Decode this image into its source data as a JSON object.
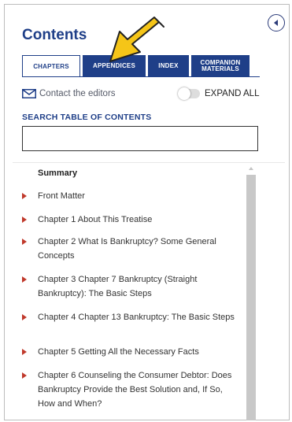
{
  "panel": {
    "title": "Contents",
    "collapse_icon": "chevron-left-circle-icon"
  },
  "tabs": [
    {
      "label": "CHAPTERS",
      "active": true
    },
    {
      "label": "APPENDICES",
      "active": false
    },
    {
      "label": "INDEX",
      "active": false
    },
    {
      "label": "COMPANION MATERIALS",
      "active": false
    }
  ],
  "contact": {
    "icon": "envelope-icon",
    "label": "Contact the editors"
  },
  "expand": {
    "label": "EXPAND ALL",
    "toggle_on": false
  },
  "search": {
    "label": "SEARCH TABLE OF CONTENTS",
    "value": "",
    "placeholder": ""
  },
  "toc": {
    "heading": "Summary",
    "items": [
      "Front Matter",
      "Chapter 1 About This Treatise",
      "Chapter 2 What Is Bankruptcy? Some General Concepts",
      "Chapter 3 Chapter 7 Bankruptcy (Straight Bankruptcy): The Basic Steps",
      "Chapter 4 Chapter 13 Bankruptcy: The Basic Steps",
      "Chapter 5 Getting All the Necessary Facts",
      "Chapter 6 Counseling the Consumer Debtor: Does Bankruptcy Provide the Best Solution and, If So, How and When?"
    ]
  },
  "colors": {
    "brand": "#1f3f88",
    "arrow": "#c0392b",
    "pointer": "#f5c518"
  }
}
